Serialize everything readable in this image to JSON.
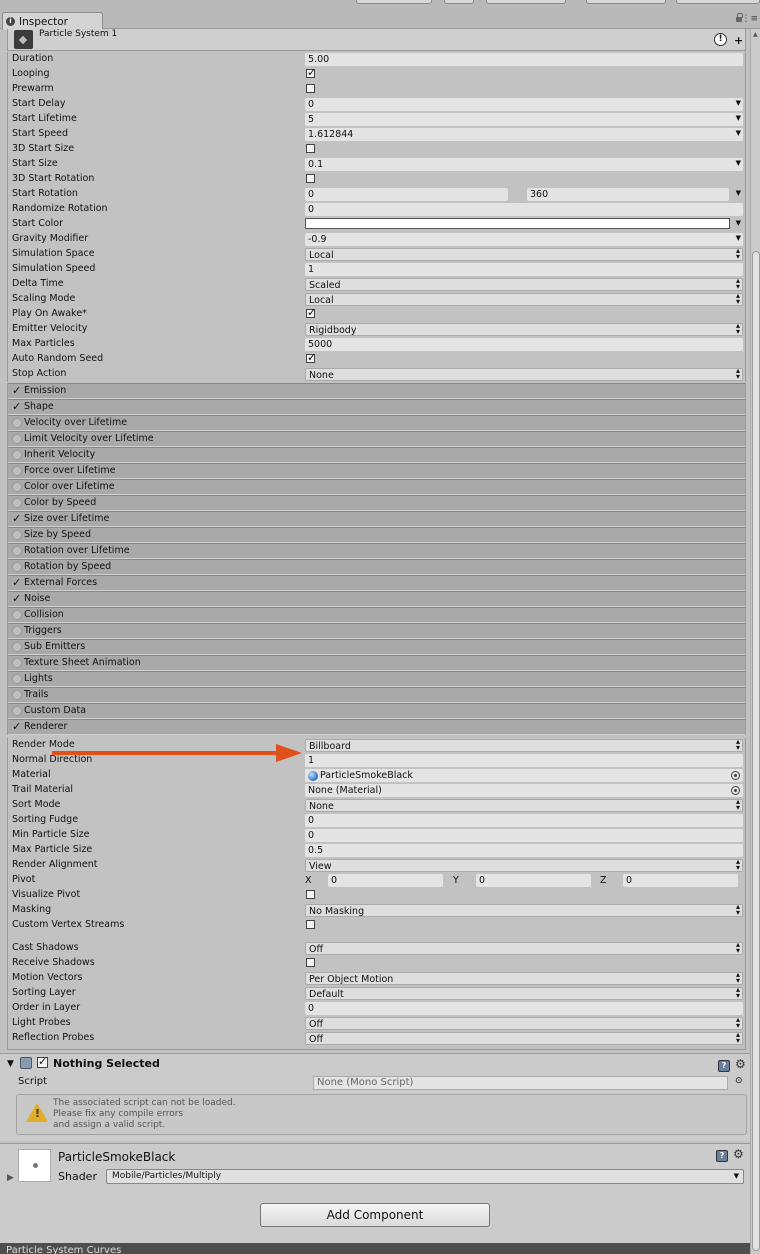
{
  "tab": {
    "title": "Inspector"
  },
  "particle_system": {
    "title": "Particle System 1",
    "properties": [
      {
        "label": "Duration",
        "value": "5.00",
        "kind": "field"
      },
      {
        "label": "Looping",
        "checked": true,
        "kind": "check"
      },
      {
        "label": "Prewarm",
        "checked": false,
        "kind": "check"
      },
      {
        "label": "Start Delay",
        "value": "0",
        "kind": "curve"
      },
      {
        "label": "Start Lifetime",
        "value": "5",
        "kind": "curve"
      },
      {
        "label": "Start Speed",
        "value": "1.612844",
        "kind": "curve"
      },
      {
        "label": "3D Start Size",
        "checked": false,
        "kind": "check"
      },
      {
        "label": "Start Size",
        "value": "0.1",
        "kind": "curve"
      },
      {
        "label": "3D Start Rotation",
        "checked": false,
        "kind": "check"
      },
      {
        "label": "Start Rotation",
        "value": "0",
        "value2": "360",
        "kind": "range"
      },
      {
        "label": "Randomize Rotation",
        "value": "0",
        "kind": "field"
      },
      {
        "label": "Start Color",
        "kind": "color"
      },
      {
        "label": "Gravity Modifier",
        "value": "-0.9",
        "kind": "curve"
      },
      {
        "label": "Simulation Space",
        "value": "Local",
        "kind": "dropdown"
      },
      {
        "label": "Simulation Speed",
        "value": "1",
        "kind": "field"
      },
      {
        "label": "Delta Time",
        "value": "Scaled",
        "kind": "dropdown"
      },
      {
        "label": "Scaling Mode",
        "value": "Local",
        "kind": "dropdown"
      },
      {
        "label": "Play On Awake*",
        "checked": true,
        "kind": "check"
      },
      {
        "label": "Emitter Velocity",
        "value": "Rigidbody",
        "kind": "dropdown"
      },
      {
        "label": "Max Particles",
        "value": "5000",
        "kind": "field"
      },
      {
        "label": "Auto Random Seed",
        "checked": true,
        "kind": "check"
      },
      {
        "label": "Stop Action",
        "value": "None",
        "kind": "dropdown"
      }
    ],
    "modules": [
      {
        "label": "Emission",
        "enabled": true
      },
      {
        "label": "Shape",
        "enabled": true
      },
      {
        "label": "Velocity over Lifetime",
        "enabled": false
      },
      {
        "label": "Limit Velocity over Lifetime",
        "enabled": false
      },
      {
        "label": "Inherit Velocity",
        "enabled": false
      },
      {
        "label": "Force over Lifetime",
        "enabled": false
      },
      {
        "label": "Color over Lifetime",
        "enabled": false
      },
      {
        "label": "Color by Speed",
        "enabled": false
      },
      {
        "label": "Size over Lifetime",
        "enabled": true
      },
      {
        "label": "Size by Speed",
        "enabled": false
      },
      {
        "label": "Rotation over Lifetime",
        "enabled": false
      },
      {
        "label": "Rotation by Speed",
        "enabled": false
      },
      {
        "label": "External Forces",
        "enabled": true
      },
      {
        "label": "Noise",
        "enabled": true
      },
      {
        "label": "Collision",
        "enabled": false
      },
      {
        "label": "Triggers",
        "enabled": false
      },
      {
        "label": "Sub Emitters",
        "enabled": false
      },
      {
        "label": "Texture Sheet Animation",
        "enabled": false
      },
      {
        "label": "Lights",
        "enabled": false
      },
      {
        "label": "Trails",
        "enabled": false
      },
      {
        "label": "Custom Data",
        "enabled": false
      },
      {
        "label": "Renderer",
        "enabled": true
      }
    ],
    "renderer": [
      {
        "label": "Render Mode",
        "value": "Billboard",
        "kind": "dropdown"
      },
      {
        "label": "Normal Direction",
        "value": "1",
        "kind": "field"
      },
      {
        "label": "Material",
        "value": "ParticleSmokeBlack",
        "kind": "object",
        "icon": "material-sphere-icon"
      },
      {
        "label": "Trail Material",
        "value": "None (Material)",
        "kind": "object"
      },
      {
        "label": "Sort Mode",
        "value": "None",
        "kind": "dropdown"
      },
      {
        "label": "Sorting Fudge",
        "value": "0",
        "kind": "field"
      },
      {
        "label": "Min Particle Size",
        "value": "0",
        "kind": "field"
      },
      {
        "label": "Max Particle Size",
        "value": "0.5",
        "kind": "field"
      },
      {
        "label": "Render Alignment",
        "value": "View",
        "kind": "dropdown"
      },
      {
        "label": "Pivot",
        "x": "0",
        "y": "0",
        "z": "0",
        "kind": "xyz"
      },
      {
        "label": "Visualize Pivot",
        "checked": false,
        "kind": "check"
      },
      {
        "label": "Masking",
        "value": "No Masking",
        "kind": "dropdown"
      },
      {
        "label": "Custom Vertex Streams",
        "checked": false,
        "kind": "check"
      },
      {
        "kind": "spacer"
      },
      {
        "label": "Cast Shadows",
        "value": "Off",
        "kind": "dropdown"
      },
      {
        "label": "Receive Shadows",
        "checked": false,
        "kind": "check"
      },
      {
        "label": "Motion Vectors",
        "value": "Per Object Motion",
        "kind": "dropdown"
      },
      {
        "label": "Sorting Layer",
        "value": "Default",
        "kind": "dropdown"
      },
      {
        "label": "Order in Layer",
        "value": "0",
        "kind": "field"
      },
      {
        "label": "Light Probes",
        "value": "Off",
        "kind": "dropdown"
      },
      {
        "label": "Reflection Probes",
        "value": "Off",
        "kind": "dropdown"
      }
    ]
  },
  "script_component": {
    "title": "Nothing Selected",
    "script_label": "Script",
    "script_value": "None (Mono Script)",
    "warning_lines": [
      "The associated script can not be loaded.",
      "Please fix any compile errors",
      "and assign a valid script."
    ]
  },
  "material": {
    "name": "ParticleSmokeBlack",
    "shader_label": "Shader",
    "shader_value": "Mobile/Particles/Multiply"
  },
  "add_component_label": "Add Component",
  "bottom_panel_title": "Particle System Curves",
  "colors": {
    "arrow": "#e0501a",
    "warning": "#e2ad28",
    "panel": "#c2c2c2"
  }
}
